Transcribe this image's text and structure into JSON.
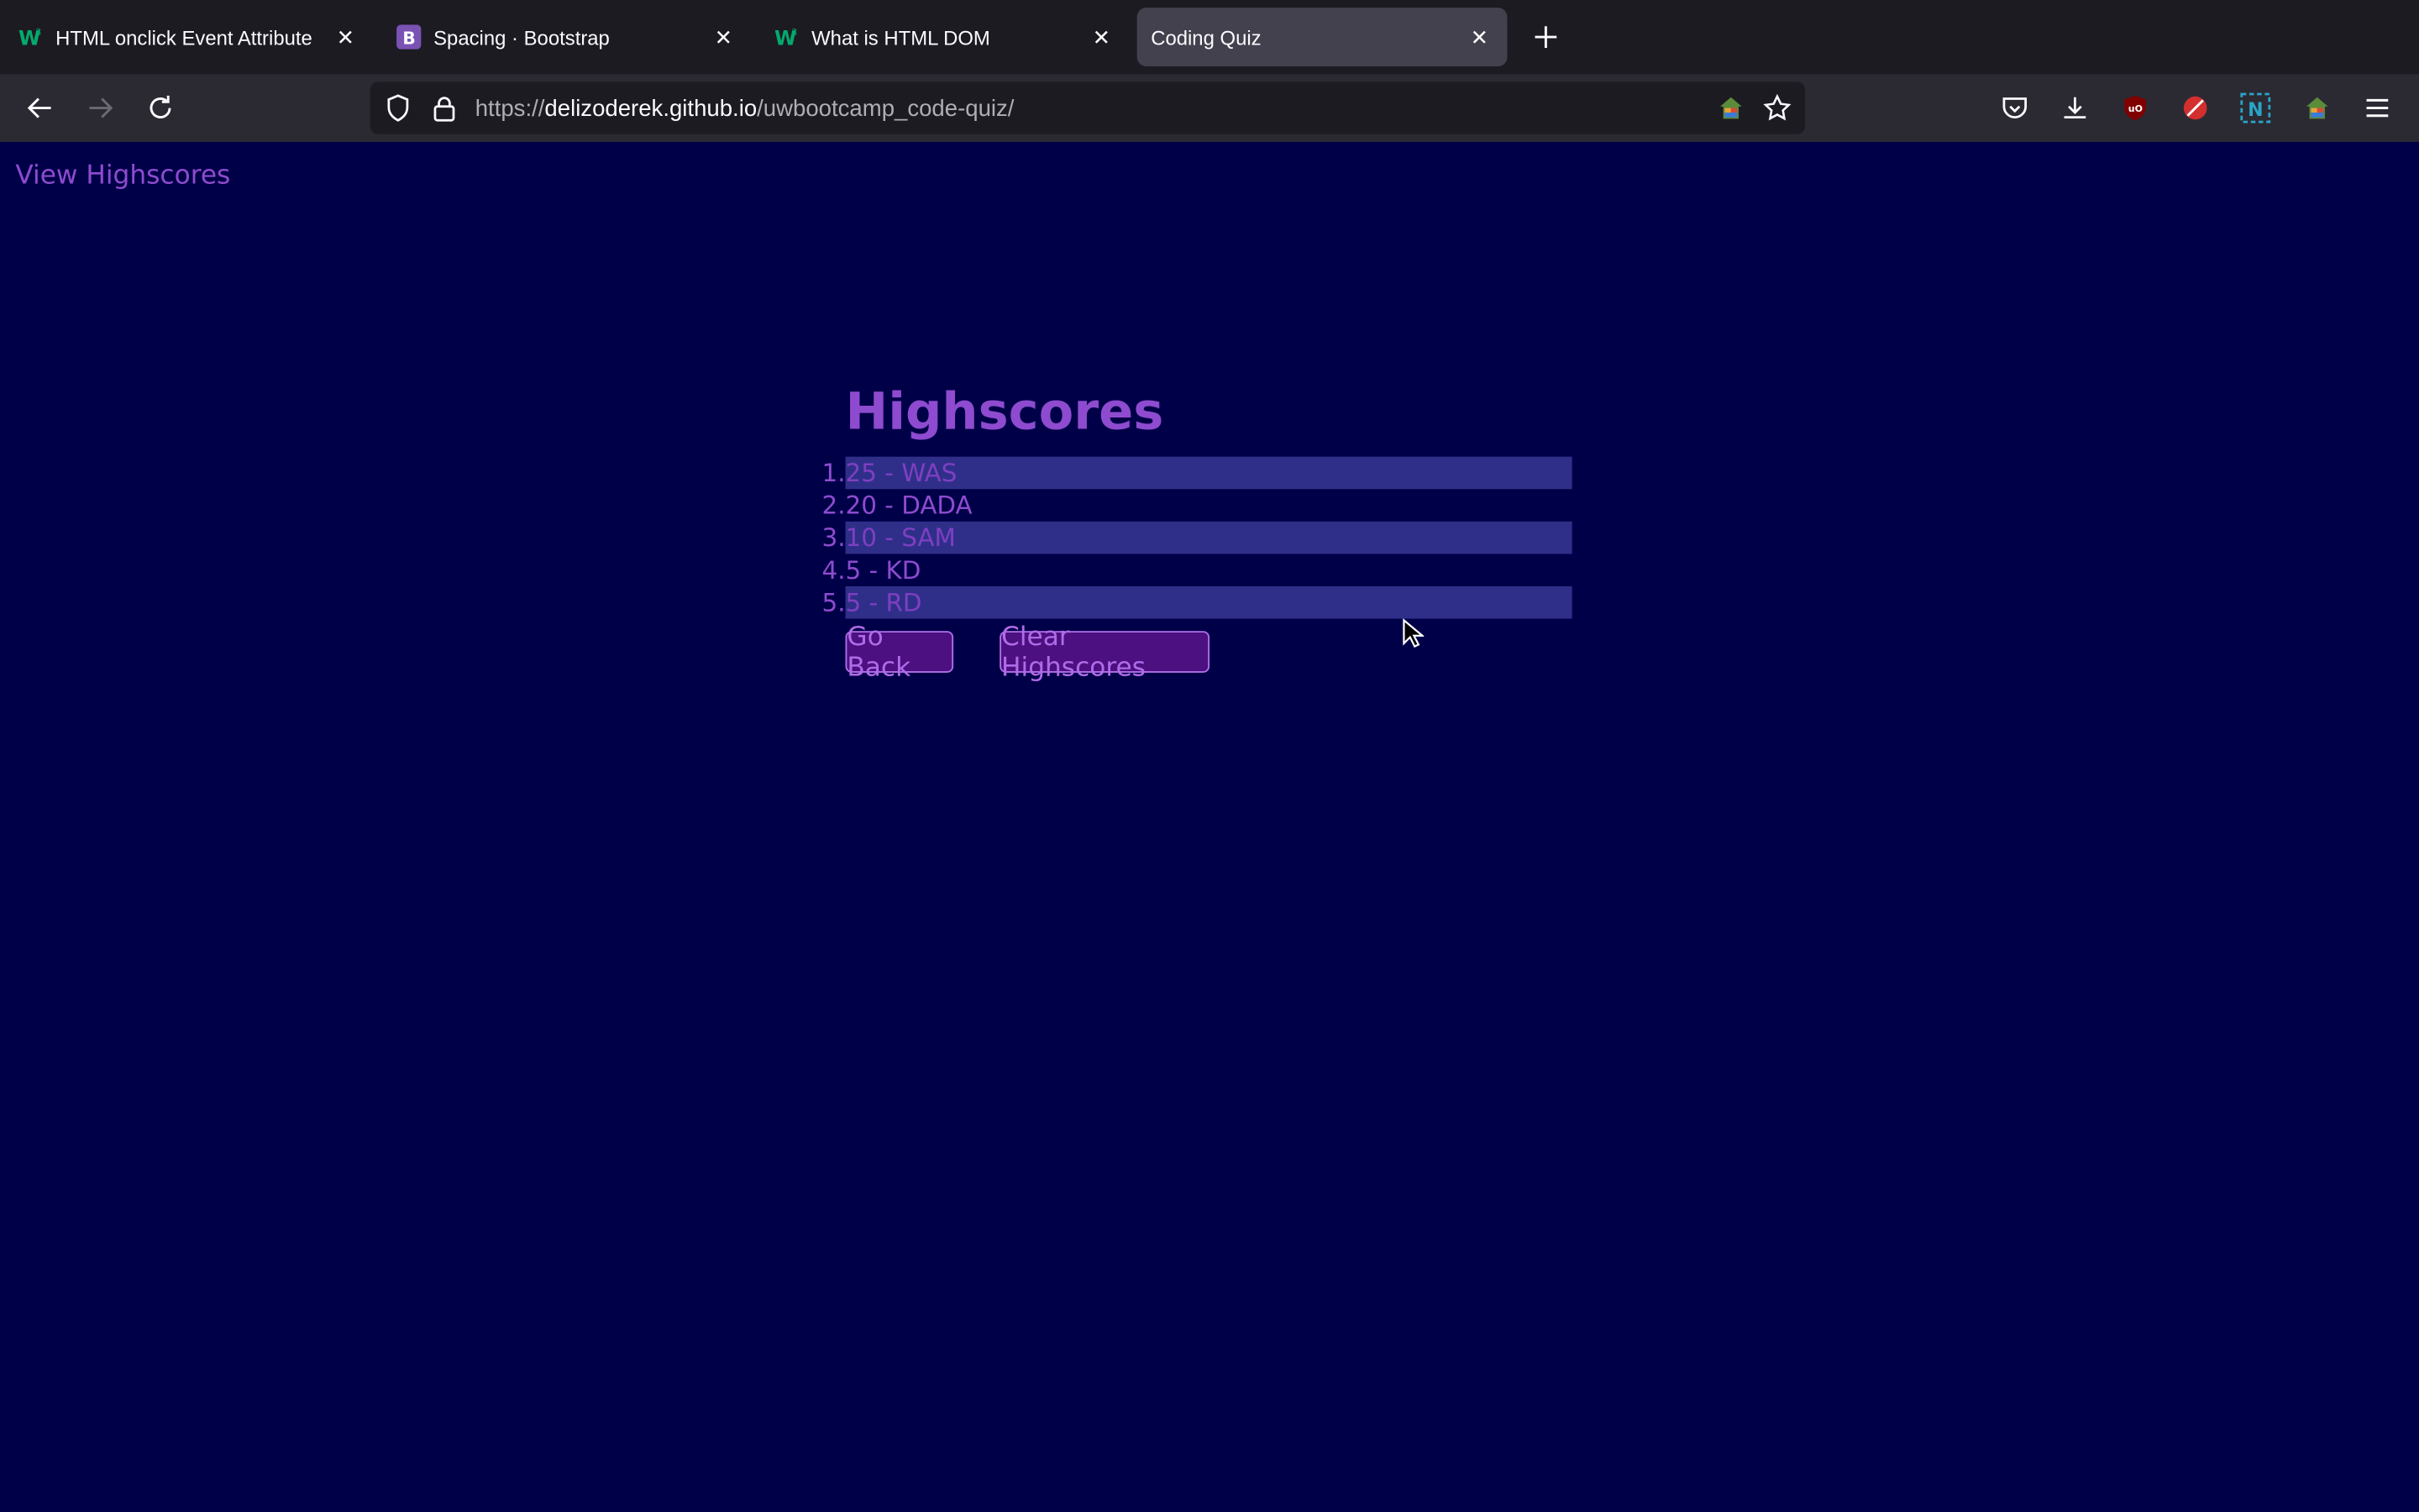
{
  "browser": {
    "tabs": [
      {
        "title": "HTML onclick Event Attribute",
        "favicon": "w3schools-icon",
        "active": false
      },
      {
        "title": "Spacing · Bootstrap",
        "favicon": "bootstrap-icon",
        "active": false
      },
      {
        "title": "What is HTML DOM",
        "favicon": "w3schools-icon",
        "active": false
      },
      {
        "title": "Coding Quiz",
        "favicon": "",
        "active": true
      }
    ],
    "url_scheme": "https://",
    "url_host": "delizoderek.github.io",
    "url_path": "/uwbootcamp_code-quiz/"
  },
  "page": {
    "view_highscores": "View Highscores",
    "title": "Highscores",
    "scores": [
      {
        "num": "1.",
        "text": "25 - WAS"
      },
      {
        "num": "2.",
        "text": "20 - DADA"
      },
      {
        "num": "3.",
        "text": "10 - SAM"
      },
      {
        "num": "4.",
        "text": "5 - KD"
      },
      {
        "num": "5.",
        "text": "5 - RD"
      }
    ],
    "go_back": "Go Back",
    "clear": "Clear Highscores"
  },
  "colors": {
    "background": "#000048",
    "accent": "#8e4bcf",
    "row_highlight": "#2f2f8a"
  }
}
